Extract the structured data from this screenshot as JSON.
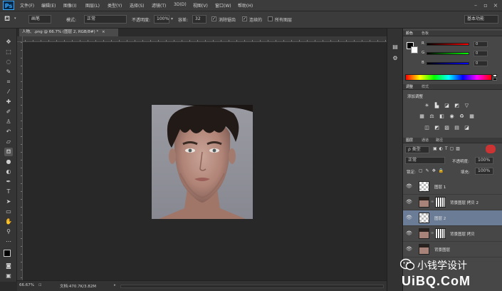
{
  "app": {
    "logo_text": "Ps",
    "menus": [
      "文件(F)",
      "编辑(E)",
      "图像(I)",
      "图层(L)",
      "类型(Y)",
      "选择(S)",
      "滤镜(T)",
      "3D(D)",
      "视图(V)",
      "窗口(W)",
      "帮助(H)"
    ]
  },
  "options": {
    "preset_value": "画笔",
    "mode_label": "模式:",
    "mode_value": "正常",
    "opacity_label": "不透明度:",
    "opacity_value": "100%",
    "tolerance_label": "容差:",
    "tolerance_value": "32",
    "antialias_label": "消除锯齿",
    "contiguous_label": "连续的",
    "all_layers_label": "所有图层",
    "workspace_value": "基本功能"
  },
  "document": {
    "tab_title": "人物、.png @ 66.7% (图层 2, RGB/8#) *",
    "close_symbol": "×"
  },
  "status": {
    "zoom": "66.67%",
    "doc_size": "文档:470.7K/3.82M"
  },
  "color_panel": {
    "tabs": [
      "颜色",
      "色板"
    ],
    "channels": [
      {
        "label": "R",
        "value": "0",
        "color": "#d33a3a"
      },
      {
        "label": "G",
        "value": "0",
        "color": "#3ad33a"
      },
      {
        "label": "B",
        "value": "0",
        "color": "#3a3ad3"
      }
    ]
  },
  "adjustments_panel": {
    "tabs": [
      "调整",
      "样式"
    ],
    "add_label": "添加调整",
    "row1_icons": [
      "brightness-icon",
      "levels-icon",
      "curves-icon",
      "exposure-icon",
      "vibrance-icon"
    ],
    "row2_icons": [
      "hue-saturation-icon",
      "color-balance-icon",
      "black-white-icon",
      "photo-filter-icon",
      "channel-mixer-icon",
      "color-lookup-icon"
    ],
    "row3_icons": [
      "invert-icon",
      "posterize-icon",
      "threshold-icon",
      "gradient-map-icon",
      "selective-color-icon"
    ]
  },
  "layers_panel": {
    "tabs": [
      "图层",
      "通道",
      "路径"
    ],
    "filter_value": "ρ 类型",
    "blend_value": "正常",
    "opacity_label": "不透明度:",
    "opacity_value": "100%",
    "lock_label": "锁定:",
    "fill_label": "填充:",
    "fill_value": "100%",
    "layers": [
      {
        "name": "图层 1",
        "thumb": "checker",
        "mask": false,
        "selected": false
      },
      {
        "name": "背景图层 拷贝 2",
        "thumb": "face",
        "mask": true,
        "selected": false
      },
      {
        "name": "图层 2",
        "thumb": "checker",
        "mask": false,
        "selected": true
      },
      {
        "name": "背景图层 拷贝",
        "thumb": "face",
        "mask": true,
        "selected": false
      },
      {
        "name": "背景图层",
        "thumb": "face",
        "mask": false,
        "selected": false
      }
    ]
  },
  "watermark": {
    "cn_text": "小钱学设计",
    "logo_text": "UiBQ.CoM"
  }
}
